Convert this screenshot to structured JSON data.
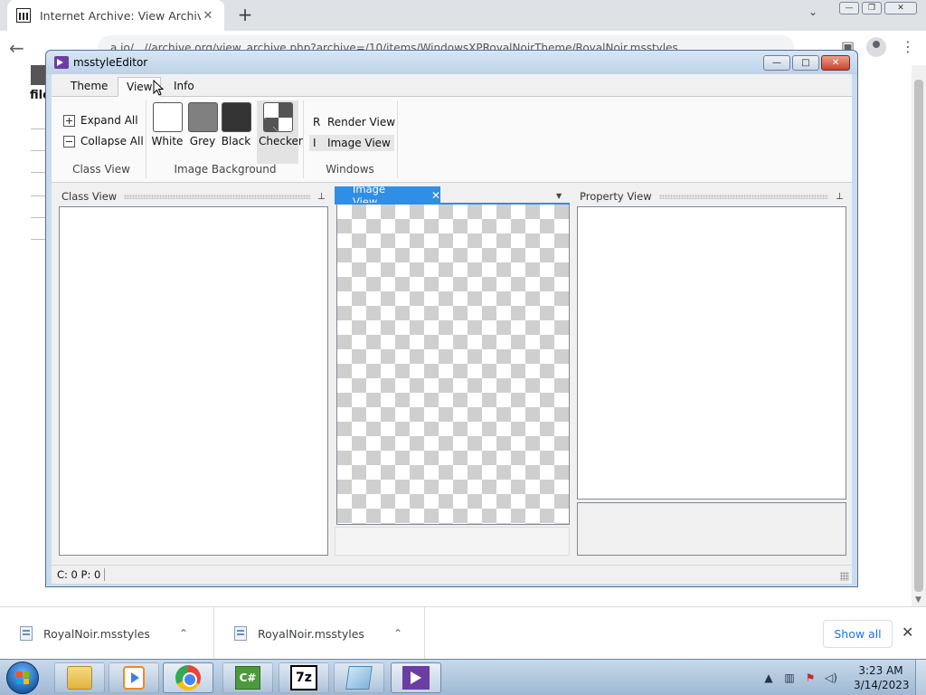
{
  "browser": {
    "tab_title": "Internet Archive: View Archive",
    "tab_close": "✕",
    "new_tab": "+",
    "tab_search": "⌄",
    "address": "a.io/...//archive.org/view_archive.php?archive=/10/items/WindowsXPRoyalNoirTheme/RoyalNoir.msstyles",
    "win_minimize": "—",
    "win_restore": "❐",
    "win_close": "✕"
  },
  "page": {
    "file_label": "file"
  },
  "app": {
    "title": "msstyleEditor",
    "caption_min": "—",
    "caption_max": "□",
    "caption_close": "✕",
    "ribbon_tabs": [
      {
        "label": "Theme"
      },
      {
        "label": "View"
      },
      {
        "label": "Info"
      }
    ],
    "class_view_group": {
      "expand_all": "Expand All",
      "collapse_all": "Collapse All",
      "label": "Class View"
    },
    "image_background_group": {
      "label": "Image Background",
      "swatches": [
        {
          "label": "White",
          "color": "#ffffff"
        },
        {
          "label": "Grey",
          "color": "#808080"
        },
        {
          "label": "Black",
          "color": "#333333"
        },
        {
          "label": "Checker",
          "color": "checker"
        }
      ]
    },
    "windows_group": {
      "label": "Windows",
      "render_view": "Render View",
      "render_view_icon": "R",
      "image_view": "Image View",
      "image_view_icon": "I"
    },
    "panes": {
      "class_view_title": "Class View",
      "image_view_tab": "Image View",
      "image_view_close": "✕",
      "property_view_title": "Property View",
      "pin_glyph": "⊥"
    },
    "status": "C: 0 P: 0"
  },
  "downloads": {
    "items": [
      {
        "name": "RoyalNoir.msstyles"
      },
      {
        "name": "RoyalNoir.msstyles"
      }
    ],
    "chevron": "⌃",
    "show_all": "Show all",
    "close": "✕"
  },
  "taskbar": {
    "csharp_label": "C#",
    "sevenzip_label": "7z",
    "time": "3:23 AM",
    "date": "3/14/2023"
  }
}
